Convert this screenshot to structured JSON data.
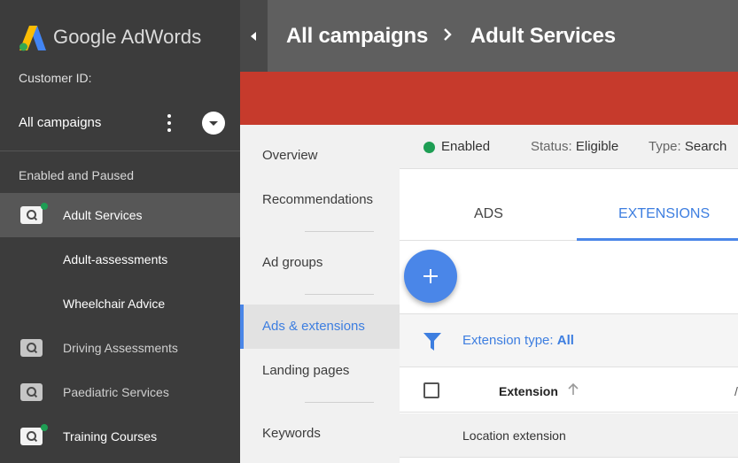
{
  "brand": {
    "name": "Google AdWords",
    "colors": {
      "blue": "#4285f4",
      "yellow": "#fbbc04",
      "green": "#34a853"
    }
  },
  "sidebar": {
    "customer_id_label": "Customer ID:",
    "account_selector": "All campaigns",
    "section_label": "Enabled and Paused",
    "items": [
      {
        "label": "Adult Services",
        "icon": "search-campaign-icon",
        "active": true,
        "status_dot": true
      },
      {
        "label": "Adult-assessments",
        "icon": null
      },
      {
        "label": "Wheelchair Advice",
        "icon": null
      },
      {
        "label": "Driving Assessments",
        "icon": "search-campaign-icon"
      },
      {
        "label": "Paediatric Services",
        "icon": "search-campaign-icon"
      },
      {
        "label": "Training Courses",
        "icon": "search-campaign-icon",
        "status_dot": true
      }
    ]
  },
  "header": {
    "breadcrumb_root": "All campaigns",
    "breadcrumb_current": "Adult Services",
    "banner_color": "#c63a2c"
  },
  "page_nav": {
    "items": [
      "Overview",
      "Recommendations",
      "Ad groups",
      "Ads & extensions",
      "Landing pages",
      "Keywords"
    ],
    "active": "Ads & extensions"
  },
  "status": {
    "state": "Enabled",
    "status_key": "Status:",
    "status_value": "Eligible",
    "type_key": "Type:",
    "type_value": "Search"
  },
  "tabs": {
    "ads": "ADS",
    "extensions": "EXTENSIONS",
    "active": "EXTENSIONS"
  },
  "filter": {
    "label": "Extension type:",
    "value": "All"
  },
  "table": {
    "column_header": "Extension",
    "rows": [
      "Location extension"
    ]
  },
  "accent_color": "#4a86e8",
  "status_green": "#1e9e54"
}
